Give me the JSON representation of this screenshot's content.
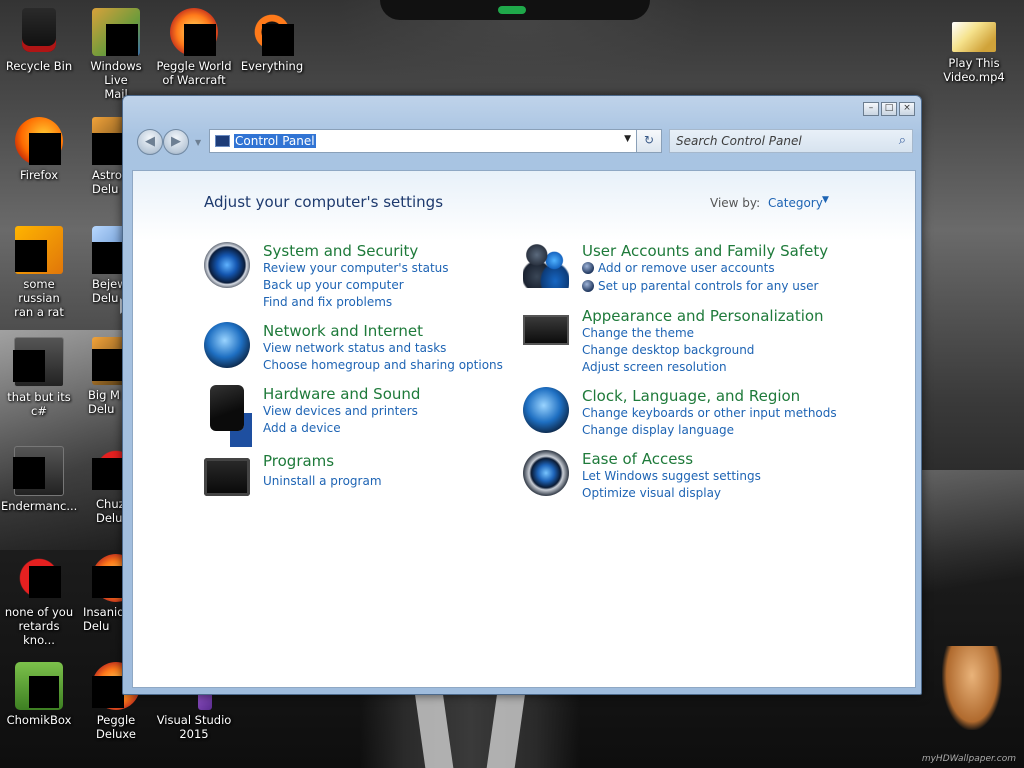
{
  "desktop": {
    "icons": [
      {
        "label": "Recycle Bin"
      },
      {
        "label": "Windows Live\nMail"
      },
      {
        "label": "Peggle World\nof Warcraft ..."
      },
      {
        "label": "Everything"
      },
      {
        "label": "Play This\nVideo.mp4"
      },
      {
        "label": "Firefox"
      },
      {
        "label": "Astro\nDelu"
      },
      {
        "label": "some russian\nran a rat"
      },
      {
        "label": "Bejew\nDelu"
      },
      {
        "label": "that but its c#"
      },
      {
        "label": "Big M\nDelu"
      },
      {
        "label": "Endermanc..."
      },
      {
        "label": "Chuz\nDelu"
      },
      {
        "label": "none of you\nretards kno..."
      },
      {
        "label": "Insaniq\nDelu"
      },
      {
        "label": "ChomikBox"
      },
      {
        "label": "Peggle Deluxe"
      },
      {
        "label": "Visual Studio\n2015"
      }
    ],
    "watermark": "myHDWallpaper.com"
  },
  "window": {
    "address": "Control Panel",
    "search_placeholder": "Search Control Panel",
    "controls": {
      "minimize": "–",
      "maximize": "□",
      "close": "×"
    }
  },
  "control_panel": {
    "heading": "Adjust your computer's settings",
    "view_by_label": "View by:",
    "view_by_value": "Category",
    "categories_left": [
      {
        "title": "System and Security",
        "links": [
          "Review your computer's status",
          "Back up your computer",
          "Find and fix problems"
        ]
      },
      {
        "title": "Network and Internet",
        "links": [
          "View network status and tasks",
          "Choose homegroup and sharing options"
        ]
      },
      {
        "title": "Hardware and Sound",
        "links": [
          "View devices and printers",
          "Add a device"
        ]
      },
      {
        "title": "Programs",
        "links": [
          "Uninstall a program"
        ]
      }
    ],
    "categories_right": [
      {
        "title": "User Accounts and Family Safety",
        "links": [
          "Add or remove user accounts",
          "Set up parental controls for any user"
        ]
      },
      {
        "title": "Appearance and Personalization",
        "links": [
          "Change the theme",
          "Change desktop background",
          "Adjust screen resolution"
        ]
      },
      {
        "title": "Clock, Language, and Region",
        "links": [
          "Change keyboards or other input methods",
          "Change display language"
        ]
      },
      {
        "title": "Ease of Access",
        "links": [
          "Let Windows suggest settings",
          "Optimize visual display"
        ]
      }
    ]
  }
}
